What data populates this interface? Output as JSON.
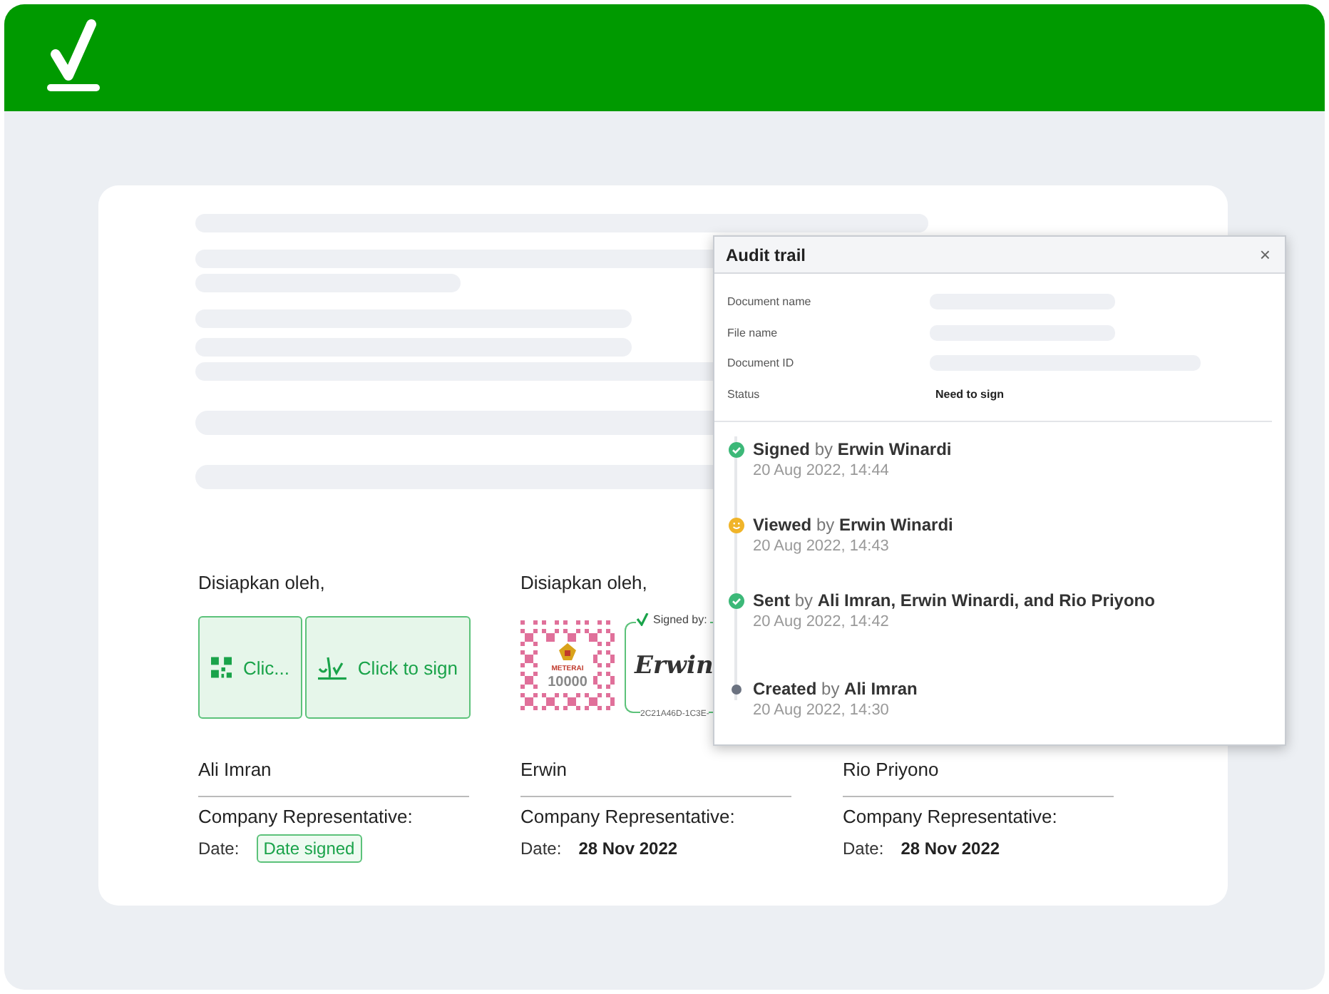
{
  "signers": [
    {
      "kind": "pending",
      "heading": "Disiapkan oleh,",
      "buttons": [
        {
          "kind": "qr",
          "label": "Clic..."
        },
        {
          "kind": "sign",
          "label": "Click to sign"
        }
      ],
      "name": "Ali Imran",
      "role": "Company Representative:",
      "date_label": "Date:",
      "date": {
        "kind": "badge",
        "text": "Date signed"
      }
    },
    {
      "kind": "signed",
      "heading": "Disiapkan oleh,",
      "stamp": {
        "title": "METERAI",
        "amount": "10000"
      },
      "signature": {
        "caption": "Signed by:",
        "name": "Erwin",
        "code": "2C21A46D-1C3E-"
      },
      "name": "Erwin",
      "role": "Company Representative:",
      "date_label": "Date:",
      "date": {
        "kind": "plain",
        "text": "28 Nov 2022"
      }
    },
    {
      "kind": "covered",
      "name": "Rio Priyono",
      "role": "Company Representative:",
      "date_label": "Date:",
      "date": {
        "kind": "plain",
        "text": "28 Nov 2022"
      }
    }
  ],
  "audit_trail": {
    "title": "Audit trail",
    "close": "×",
    "fields": [
      {
        "label": "Document name",
        "kind": "skeleton"
      },
      {
        "label": "File name",
        "kind": "skeleton"
      },
      {
        "label": "Document ID",
        "kind": "skeleton_wide"
      },
      {
        "label": "Status",
        "kind": "text",
        "value": "Need to sign"
      }
    ],
    "events": [
      {
        "kind": "done",
        "text": "**Signed** by **Erwin Winardi**",
        "time": "20 Aug 2022, 14:44"
      },
      {
        "kind": "viewed",
        "text": "**Viewed** by **Erwin Winardi**",
        "time": "20 Aug 2022, 14:43"
      },
      {
        "kind": "done",
        "text": "**Sent** by **Ali Imran, Erwin Winardi, and Rio Priyono**",
        "time": "20 Aug 2022, 14:42"
      },
      {
        "kind": "created",
        "text": "**Created** by **Ali Imran**",
        "time": "20 Aug 2022, 14:30"
      }
    ]
  }
}
